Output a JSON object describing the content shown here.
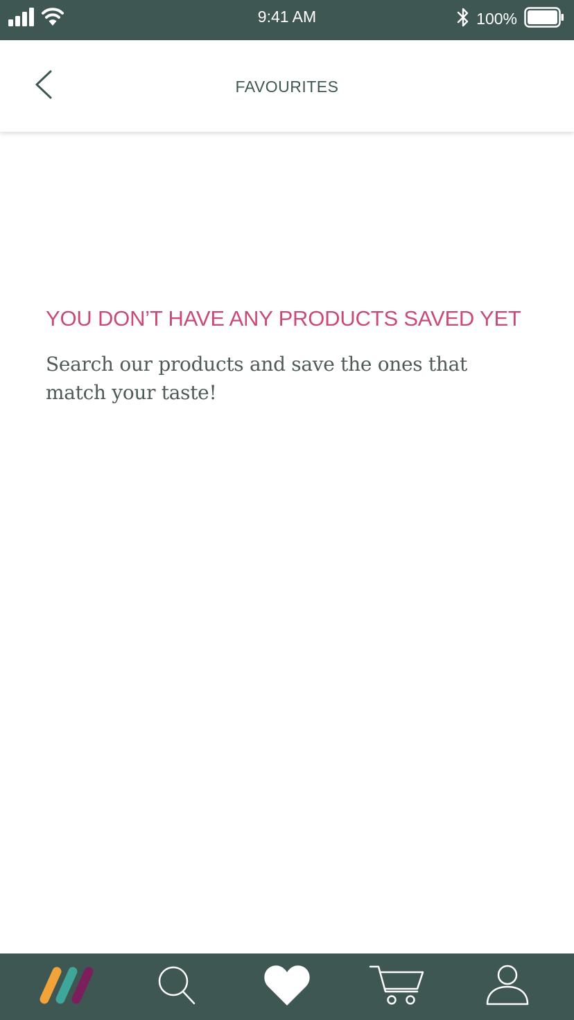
{
  "status_bar": {
    "time": "9:41 AM",
    "battery": "100%",
    "icons": [
      "signal-icon",
      "wifi-icon",
      "bluetooth-icon",
      "battery-icon"
    ]
  },
  "header": {
    "title": "FAVOURITES",
    "back_icon": "chevron-left-icon"
  },
  "empty_state": {
    "heading": "YOU DON’T HAVE ANY PRODUCTS SAVED YET",
    "message": "Search our products and save the ones that match your taste!"
  },
  "bottom_nav": {
    "items": [
      {
        "name": "home",
        "icon": "brand-logo-icon",
        "active": false
      },
      {
        "name": "search",
        "icon": "search-icon",
        "active": false
      },
      {
        "name": "favourites",
        "icon": "heart-icon",
        "active": true
      },
      {
        "name": "cart",
        "icon": "cart-icon",
        "active": false
      },
      {
        "name": "profile",
        "icon": "user-icon",
        "active": false
      }
    ]
  },
  "colors": {
    "bar_background": "#3f5753",
    "accent_pink": "#c94a78",
    "text_dark": "#4d5a58",
    "logo_orange": "#f2a33a",
    "logo_teal": "#3fa79a",
    "logo_purple": "#7a1e5c"
  }
}
